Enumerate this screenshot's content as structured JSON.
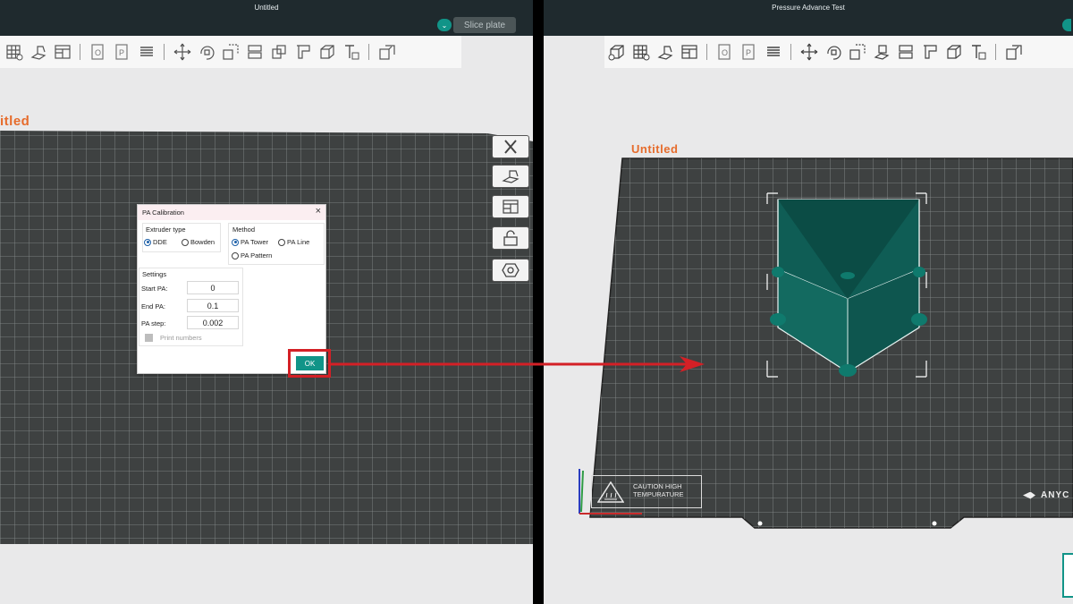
{
  "left_window": {
    "title": "Untitled",
    "slice_plate": "Slice plate",
    "plate_name": "itled"
  },
  "right_window": {
    "title": "Pressure Advance Test",
    "plate_name": "Untitled",
    "caution_label": "CAUTION HIGH TEMPURATURE",
    "brand_partial": "ANYC"
  },
  "dialog": {
    "title": "PA Calibration",
    "extruder_type": {
      "label": "Extruder type",
      "options": [
        "DDE",
        "Bowden"
      ],
      "selected": "DDE"
    },
    "method": {
      "label": "Method",
      "options": [
        "PA Tower",
        "PA Line",
        "PA Pattern"
      ],
      "selected": "PA Tower"
    },
    "settings": {
      "label": "Settings",
      "start_pa_label": "Start PA:",
      "start_pa_value": "0",
      "end_pa_label": "End PA:",
      "end_pa_value": "0.1",
      "pa_step_label": "PA step:",
      "pa_step_value": "0.002",
      "print_numbers_label": "Print numbers",
      "print_numbers_checked": false
    },
    "ok_label": "OK"
  },
  "colors": {
    "accent": "#119488",
    "highlight": "#d42026",
    "plate_name": "#e66c2c",
    "bed": "#3e4141",
    "model": "#0f5d55"
  },
  "icons": {
    "toolbar": [
      "add-cube-icon",
      "grid-icon",
      "auto-orient-icon",
      "layout-icon",
      "split-objects-icon",
      "split-parts-icon",
      "layers-icon",
      "move-icon",
      "rotate-icon",
      "scale-icon",
      "lay-flat-icon",
      "cut-icon",
      "support-paint-icon",
      "seam-paint-icon",
      "measure-icon",
      "text-icon",
      "assembly-icon"
    ],
    "side": [
      "close-x-icon",
      "auto-orient-icon",
      "arrange-icon",
      "lock-icon",
      "settings-hex-icon"
    ]
  }
}
